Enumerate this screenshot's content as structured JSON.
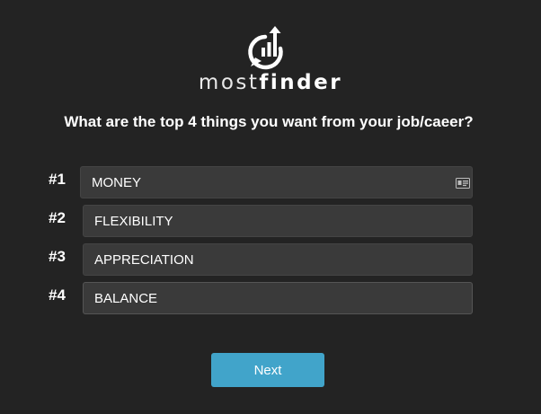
{
  "brand": {
    "light": "most",
    "bold": "finder",
    "logo_icon": "chart-speech-bubble-logo-icon"
  },
  "question": "What are the top 4 things you want from your job/caeer?",
  "answers": [
    {
      "label": "#1",
      "value": "MONEY"
    },
    {
      "label": "#2",
      "value": "FLEXIBILITY"
    },
    {
      "label": "#3",
      "value": "APPRECIATION"
    },
    {
      "label": "#4",
      "value": "BALANCE"
    }
  ],
  "autofill_icon": "contact-card-icon",
  "next_label": "Next",
  "colors": {
    "background": "#232323",
    "field_background": "#3a3a3a",
    "button": "#41a4ca",
    "text": "#ffffff"
  }
}
